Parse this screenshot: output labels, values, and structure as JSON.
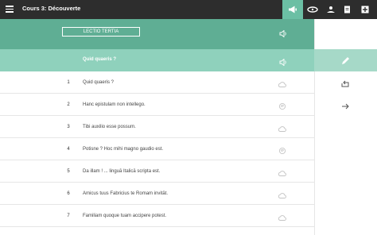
{
  "app": {
    "title": "Cours 3: Découverte"
  },
  "toolbar": {
    "icons": [
      "megaphone-icon",
      "gramophone-icon",
      "hand-reader-icon",
      "document-icon",
      "add-icon"
    ]
  },
  "lesson": {
    "header": "LECTIO TERTIA",
    "question": "Quid quaeris ?"
  },
  "sentences": [
    {
      "num": "1",
      "text": "Quid quaeris ?",
      "status": "cloud"
    },
    {
      "num": "2",
      "text": "Hanc epistulam non intellego.",
      "status": "bird"
    },
    {
      "num": "3",
      "text": "Tibi auxilio esse possum.",
      "status": "cloud"
    },
    {
      "num": "4",
      "text": "Potisne ? Hoc mihi magno gaudio est.",
      "status": "bird"
    },
    {
      "num": "5",
      "text": "Da illam ! ... linguā Italicā scripta est.",
      "status": "cloud"
    },
    {
      "num": "6",
      "text": "Amicus tuus Fabricius te Romam invitāt.",
      "status": "cloud"
    },
    {
      "num": "7",
      "text": "Familiam quoque tuam accipere potest.",
      "status": "cloud"
    }
  ],
  "colors": {
    "topbar": "#2d2d2d",
    "header": "#5fae94",
    "question": "#8fd1bc",
    "accent": "#6bbfa4"
  }
}
